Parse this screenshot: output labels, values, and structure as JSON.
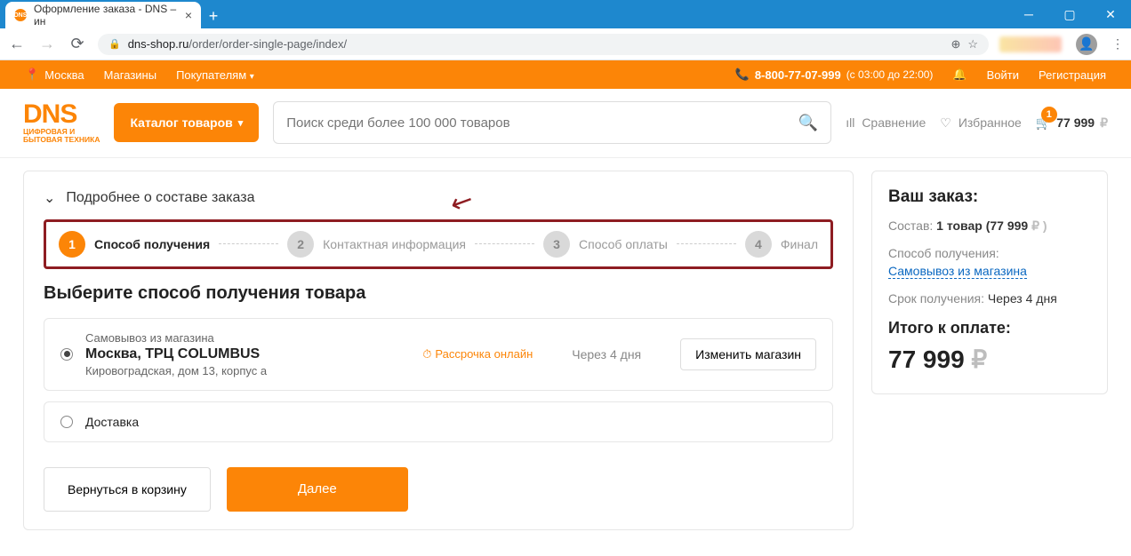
{
  "browser": {
    "tab_title": "Оформление заказа - DNS – ин",
    "url_host": "dns-shop.ru",
    "url_path": "/order/order-single-page/index/"
  },
  "topbar": {
    "city": "Москва",
    "stores": "Магазины",
    "buyers": "Покупателям",
    "phone": "8-800-77-07-999",
    "hours": "(с 03:00 до 22:00)",
    "login": "Войти",
    "register": "Регистрация"
  },
  "header": {
    "logo_main": "DNS",
    "logo_sub1": "ЦИФРОВАЯ И",
    "logo_sub2": "БЫТОВАЯ ТЕХНИКА",
    "catalog": "Каталог товаров",
    "search_placeholder": "Поиск среди более 100 000 товаров",
    "compare": "Сравнение",
    "fav": "Избранное",
    "cart_badge": "1",
    "cart_total": "77 999",
    "rub": "₽"
  },
  "main": {
    "details_toggle": "Подробнее о составе заказа",
    "steps": [
      {
        "n": "1",
        "label": "Способ получения"
      },
      {
        "n": "2",
        "label": "Контактная информация"
      },
      {
        "n": "3",
        "label": "Способ оплаты"
      },
      {
        "n": "4",
        "label": "Финал"
      }
    ],
    "section_title": "Выберите способ получения товара",
    "pickup": {
      "caption": "Самовывоз из магазина",
      "store": "Москва, ТРЦ COLUMBUS",
      "addr": "Кировоградская, дом 13, корпус а",
      "installment": "Рассрочка онлайн",
      "eta": "Через 4 дня",
      "change": "Изменить магазин"
    },
    "delivery_label": "Доставка",
    "back": "Вернуться в корзину",
    "next": "Далее"
  },
  "sidebar": {
    "title": "Ваш заказ:",
    "contents_pre": "Состав: ",
    "contents_val": "1 товар (77 999",
    "contents_rub": "₽ )",
    "method_label": "Способ получения:",
    "method_link": "Самовывоз из магазина",
    "eta_label": "Срок получения: ",
    "eta_val": "Через 4 дня",
    "total_label": "Итого к оплате:",
    "total_val": "77 999",
    "rub": "₽"
  }
}
